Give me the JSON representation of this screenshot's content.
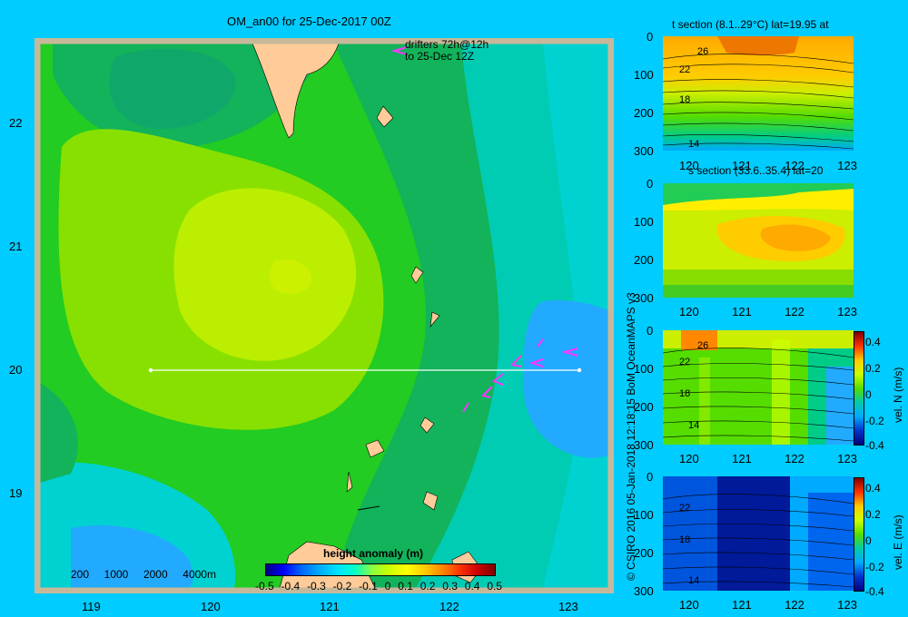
{
  "main_map": {
    "title": "OM_an00 for 25-Dec-2017 00Z",
    "drifters_line1": "drifters 72h@12h",
    "drifters_line2": "to 25-Dec 12Z",
    "depth_legend": [
      "200",
      "1000",
      "2000",
      "4000m"
    ],
    "colorbar_title": "height anomaly  (m)",
    "colorbar_ticks": [
      "-0.5",
      "-0.4",
      "-0.3",
      "-0.2",
      "-0.1",
      "0",
      "0.1",
      "0.2",
      "0.3",
      "0.4",
      "0.5"
    ],
    "lat_ticks": [
      "22",
      "21",
      "20",
      "19"
    ],
    "lon_ticks": [
      "119",
      "120",
      "121",
      "122",
      "123"
    ],
    "section_lat": 20,
    "section_lon_range": [
      119.5,
      123.2
    ],
    "colors": {
      "land": "#ffcc99",
      "frame": "#c8b89a",
      "drifter": "#ff33ff"
    }
  },
  "copyright": "© CSIRO 2016   05-Jan-2018 12:18:15 BoM OceanMAPS v3",
  "panels": [
    {
      "title": "t section (8.1..29°C) lat=19.95 at",
      "contours": [
        "26",
        "22",
        "18",
        "14"
      ],
      "bar": false
    },
    {
      "title": "s section (33.6..35.4) lat=20",
      "contours": [],
      "bar": false
    },
    {
      "title": "",
      "contours": [
        "26",
        "22",
        "18",
        "14"
      ],
      "bar": true,
      "bar_label": "vel. N  (m/s)"
    },
    {
      "title": "",
      "contours": [
        "22",
        "18",
        "14"
      ],
      "bar": true,
      "bar_label": "vel. E  (m/s)"
    }
  ],
  "depth_ticks": [
    "0",
    "100",
    "200",
    "300"
  ],
  "section_lon_ticks": [
    "120",
    "121",
    "122",
    "123"
  ],
  "vel_ticks": [
    "0.4",
    "0.2",
    "0",
    "-0.2",
    "-0.4"
  ]
}
